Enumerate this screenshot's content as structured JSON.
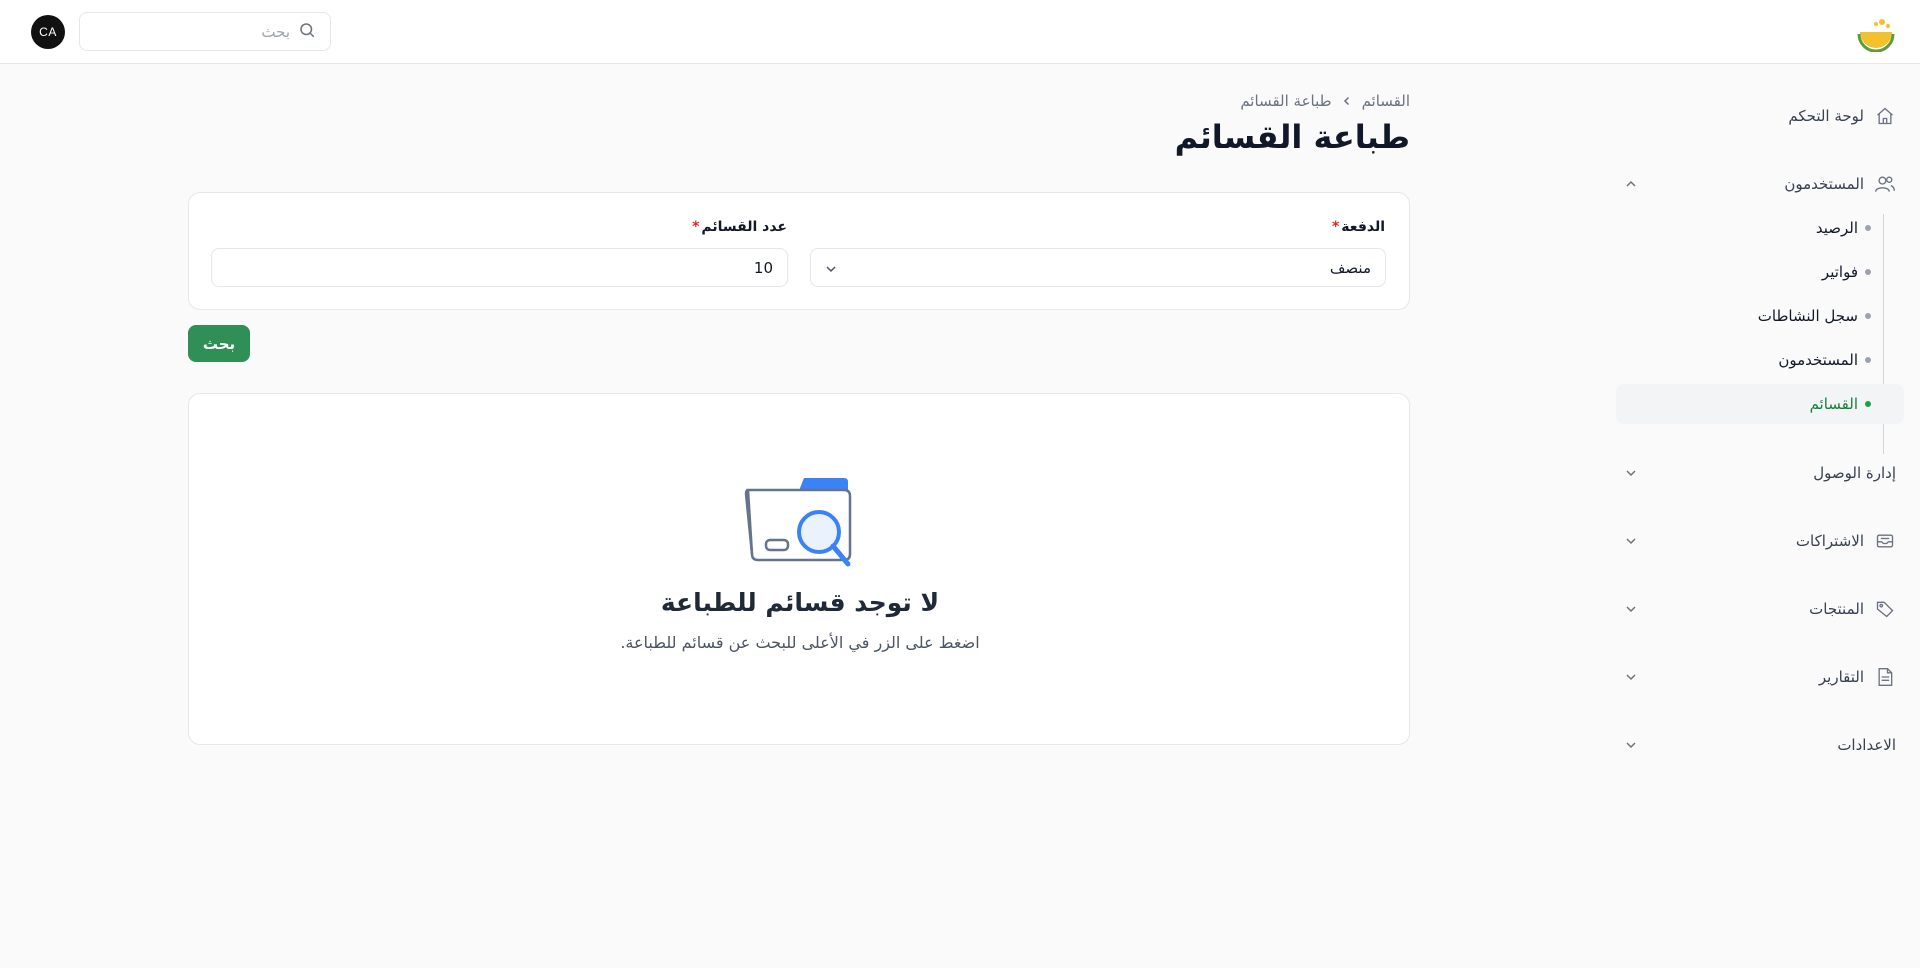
{
  "header": {
    "search_placeholder": "بحث",
    "avatar_initials": "CA"
  },
  "sidebar": {
    "items": [
      {
        "label": "لوحة التحكم",
        "icon": "home-icon"
      },
      {
        "label": "المستخدمون",
        "icon": "users-icon",
        "expanded": true
      },
      {
        "label": "إدارة الوصول",
        "icon": ""
      },
      {
        "label": "الاشتراكات",
        "icon": "inbox-icon"
      },
      {
        "label": "المنتجات",
        "icon": "tag-icon"
      },
      {
        "label": "التقارير",
        "icon": "file-icon"
      },
      {
        "label": "الاعدادات",
        "icon": ""
      }
    ],
    "sub_items": [
      {
        "label": "الرصيد"
      },
      {
        "label": "فواتير"
      },
      {
        "label": "سجل النشاطات"
      },
      {
        "label": "المستخدمون"
      },
      {
        "label": "القسائم",
        "active": true
      }
    ]
  },
  "breadcrumb": {
    "parent": "القسائم",
    "current": "طباعة القسائم"
  },
  "page": {
    "title": "طباعة القسائم"
  },
  "form": {
    "batch_label": "الدفعة",
    "batch_value": "منصف",
    "count_label": "عدد القسائم",
    "count_value": "10",
    "required_mark": "*"
  },
  "search_button": "بحث",
  "empty_state": {
    "title": "لا توجد قسائم للطباعة",
    "subtitle": "اضغط على الزر في الأعلى للبحث عن قسائم للطباعة."
  },
  "colors": {
    "accent": "#2f8f57",
    "active_text": "#15803d",
    "illustration": "#3b82f6"
  }
}
